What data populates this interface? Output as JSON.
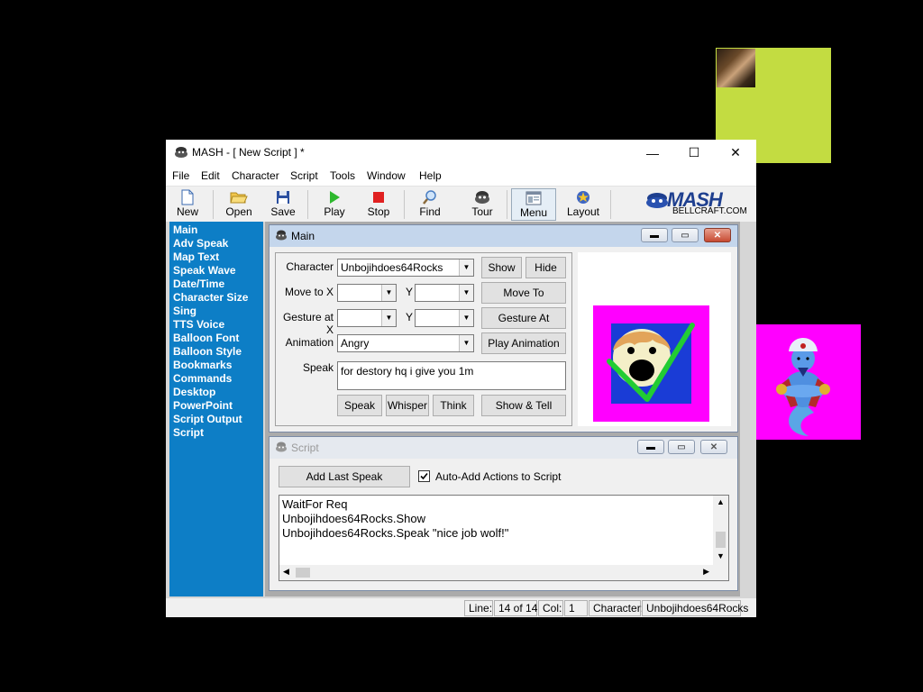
{
  "window": {
    "title": "MASH - [ New Script ] *",
    "minimize": "—",
    "maximize": "☐",
    "close": "✕"
  },
  "menu": [
    "File",
    "Edit",
    "Character",
    "Script",
    "Tools",
    "Window",
    "Help"
  ],
  "toolbar": {
    "new": "New",
    "open": "Open",
    "save": "Save",
    "play": "Play",
    "stop": "Stop",
    "find": "Find",
    "tour": "Tour",
    "menu": "Menu",
    "layout": "Layout"
  },
  "brand": {
    "logo": "MASH",
    "site": "BELLCRAFT.COM"
  },
  "sidebar": {
    "items": [
      "Main",
      "Adv Speak",
      "Map Text",
      "Speak Wave",
      "Date/Time",
      "Character Size",
      "Sing",
      "TTS Voice",
      "Balloon Font",
      "Balloon Style",
      "Bookmarks",
      "Commands",
      "Desktop",
      "PowerPoint",
      "Script Output",
      "Script"
    ]
  },
  "main_window": {
    "title": "Main",
    "character_label": "Character",
    "character_value": "Unbojihdoes64Rocks",
    "show_button": "Show",
    "hide_button": "Hide",
    "move_to_label": "Move to X",
    "y_label": "Y",
    "move_to_button": "Move To",
    "gesture_at_label": "Gesture at X",
    "gesture_at_button": "Gesture At",
    "animation_label": "Animation",
    "animation_value": "Angry",
    "play_animation_button": "Play Animation",
    "speak_label": "Speak",
    "speak_value": "for destory hq i give you 1m",
    "speak_button": "Speak",
    "whisper_button": "Whisper",
    "think_button": "Think",
    "show_tell_button": "Show & Tell"
  },
  "script_window": {
    "title": "Script",
    "add_last_speak": "Add Last Speak",
    "auto_add_label": "Auto-Add Actions to Script",
    "auto_add_checked": true,
    "lines": [
      "WaitFor Req",
      "Unbojihdoes64Rocks.Show",
      "Unbojihdoes64Rocks.Speak \"nice job wolf!\""
    ]
  },
  "status": {
    "line_label": "Line:",
    "line_value": "14 of 14",
    "col_label": "Col:",
    "col_value": "1",
    "character_label": "Character:",
    "character_value": "Unbojihdoes64Rocks"
  },
  "colors": {
    "sidebar_bg": "#0d7ec6",
    "magenta": "#ff00ff",
    "lime": "#c3dc41",
    "character_blue": "#1a3cd6",
    "checkmark_green": "#22cc33"
  },
  "icons": [
    "app-icon",
    "new-file-icon",
    "open-folder-icon",
    "save-disk-icon",
    "play-icon",
    "stop-icon",
    "find-magnifier-icon",
    "tour-icon",
    "menu-icon",
    "layout-icon",
    "mash-logo-icon"
  ]
}
